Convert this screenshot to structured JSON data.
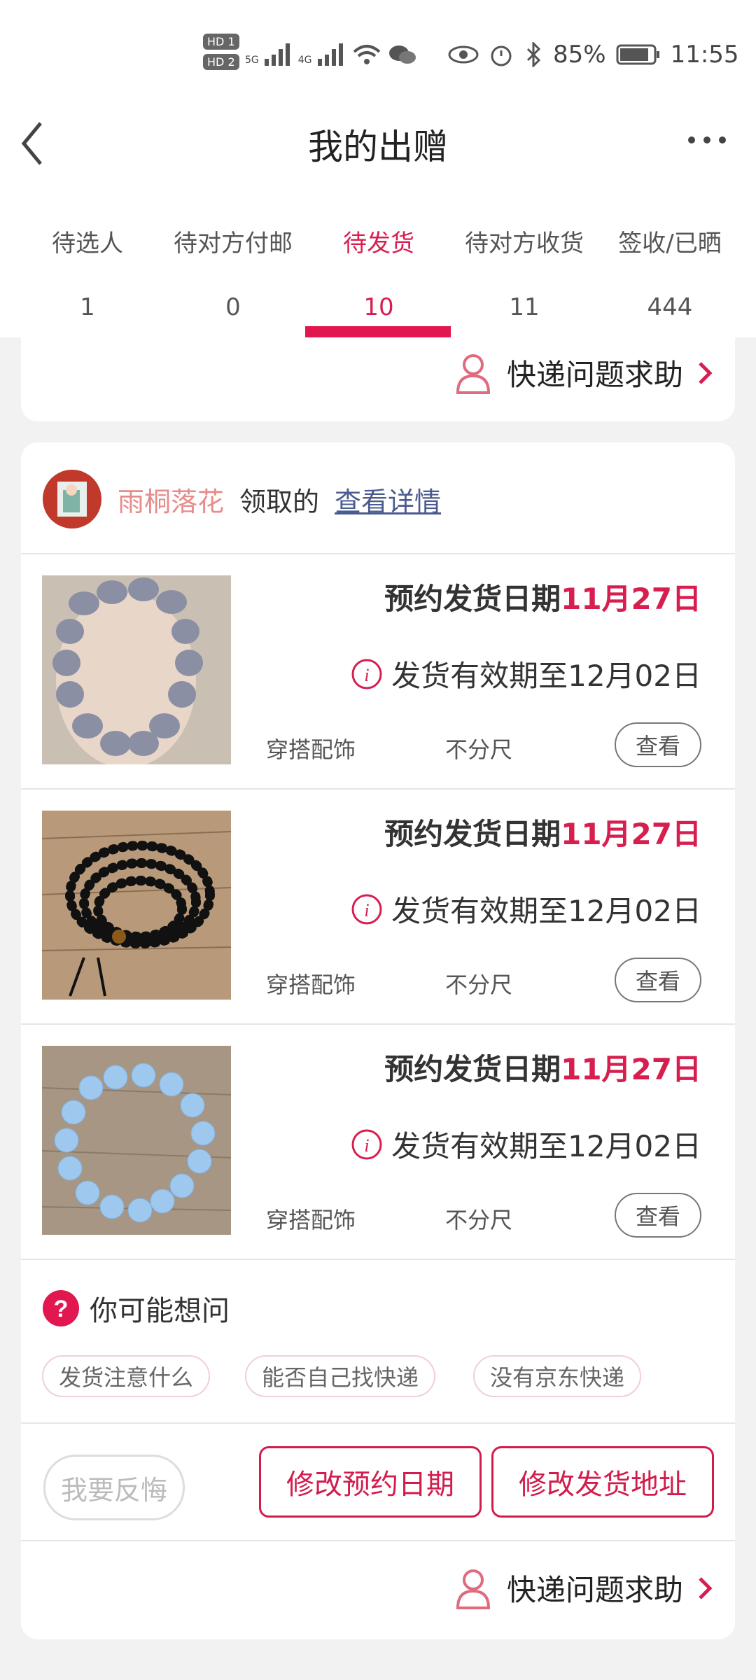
{
  "status_bar": {
    "hd1": "HD 1",
    "hd2": "HD 2",
    "net1": "5G",
    "net2": "4G",
    "battery_percent": "85%",
    "time": "11:55"
  },
  "nav": {
    "title": "我的出赠",
    "back_icon": "chevron-left-icon",
    "more_icon": "more-dots-icon"
  },
  "tabs": [
    {
      "label": "待选人",
      "count": "1"
    },
    {
      "label": "待对方付邮",
      "count": "0"
    },
    {
      "label": "待发货",
      "count": "10",
      "active": true
    },
    {
      "label": "待对方收货",
      "count": "11"
    },
    {
      "label": "签收/已晒",
      "count": "444"
    }
  ],
  "help": {
    "label": "快递问题求助"
  },
  "order": {
    "user_name": "雨桐落花",
    "received_text": "领取的",
    "detail_link": "查看详情",
    "items": [
      {
        "date_prefix": "预约发货日期",
        "date_highlight": "11月27日",
        "valid_text": "发货有效期至12月02日",
        "category": "穿搭配饰",
        "size": "不分尺",
        "view_label": "查看"
      },
      {
        "date_prefix": "预约发货日期",
        "date_highlight": "11月27日",
        "valid_text": "发货有效期至12月02日",
        "category": "穿搭配饰",
        "size": "不分尺",
        "view_label": "查看"
      },
      {
        "date_prefix": "预约发货日期",
        "date_highlight": "11月27日",
        "valid_text": "发货有效期至12月02日",
        "category": "穿搭配饰",
        "size": "不分尺",
        "view_label": "查看"
      }
    ]
  },
  "faq": {
    "title": "你可能想问",
    "chips": [
      "发货注意什么",
      "能否自己找快递",
      "没有京东快递"
    ]
  },
  "actions": {
    "regret": "我要反悔",
    "change_date": "修改预约日期",
    "change_address": "修改发货地址"
  },
  "colors": {
    "accent": "#d81e4f",
    "background": "#f2f2f2"
  }
}
